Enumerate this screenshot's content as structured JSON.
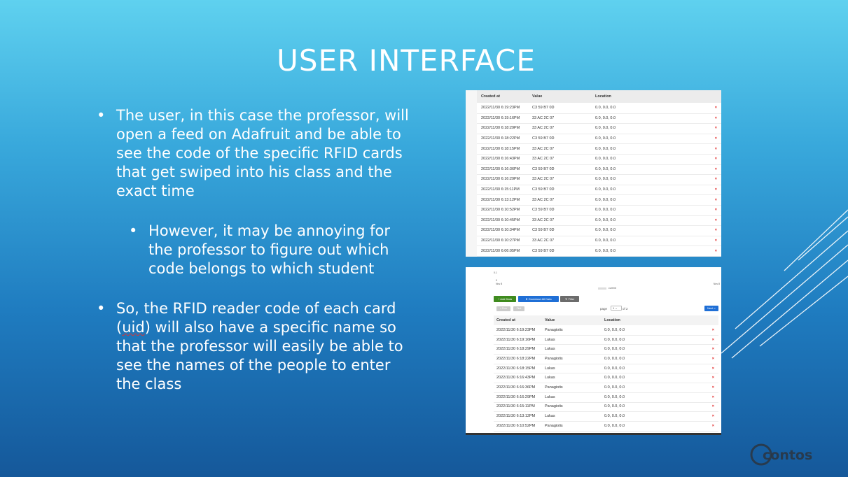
{
  "title": "USER INTERFACE",
  "bullets": {
    "b1": "The user, in this case the professor, will open a feed on Adafruit and be able to see the code of the specific RFID cards that get swiped into his class and the exact time",
    "b2": "However, it may be annoying for the professor to figure out which code belongs to which student",
    "b3_pre": "So, the RFID reader code of each card (",
    "b3_uid": "uid",
    "b3_post": ") will also have a specific name so that the professor will easily be able to see the names of the people to enter the class"
  },
  "panel1": {
    "headers": [
      "Created at",
      "Value",
      "Location"
    ],
    "rows": [
      [
        "2022/11/30 6:19:23PM",
        "C3 59 B7 0D",
        "0.0, 0.0, 0.0"
      ],
      [
        "2022/11/30 6:19:16PM",
        "33 AC 2C 07",
        "0.0, 0.0, 0.0"
      ],
      [
        "2022/11/30 6:18:29PM",
        "33 AC 2C 07",
        "0.0, 0.0, 0.0"
      ],
      [
        "2022/11/30 6:18:22PM",
        "C3 59 B7 0D",
        "0.0, 0.0, 0.0"
      ],
      [
        "2022/11/30 6:18:15PM",
        "33 AC 2C 07",
        "0.0, 0.0, 0.0"
      ],
      [
        "2022/11/30 6:16:43PM",
        "33 AC 2C 07",
        "0.0, 0.0, 0.0"
      ],
      [
        "2022/11/30 6:16:36PM",
        "C3 59 B7 0D",
        "0.0, 0.0, 0.0"
      ],
      [
        "2022/11/30 6:16:29PM",
        "33 AC 2C 07",
        "0.0, 0.0, 0.0"
      ],
      [
        "2022/11/30 6:15:11PM",
        "C3 59 B7 0D",
        "0.0, 0.0, 0.0"
      ],
      [
        "2022/11/30 6:13:12PM",
        "33 AC 2C 07",
        "0.0, 0.0, 0.0"
      ],
      [
        "2022/11/30 6:10:52PM",
        "C3 59 B7 0D",
        "0.0, 0.0, 0.0"
      ],
      [
        "2022/11/30 6:10:45PM",
        "33 AC 2C 07",
        "0.0, 0.0, 0.0"
      ],
      [
        "2022/11/30 6:10:34PM",
        "C3 59 B7 0D",
        "0.0, 0.0, 0.0"
      ],
      [
        "2022/11/30 6:10:27PM",
        "33 AC 2C 07",
        "0.0, 0.0, 0.0"
      ],
      [
        "2022/11/30 6:06:05PM",
        "C3 59 B7 0D",
        "0.0, 0.0, 0.0"
      ]
    ],
    "delete_glyph": "×"
  },
  "panel2": {
    "chart_top_label": "0.1",
    "chart_zero": "0",
    "date_left": "Nov 8",
    "date_right": "Nov 8",
    "legend": "current",
    "add_data": "+ Add Data",
    "download": "Download All Data",
    "filter": "Filter",
    "prev": "< Prev",
    "first": "First",
    "page_label": "page",
    "page_value": "1",
    "page_of": "of 2",
    "next": "Next >",
    "headers": [
      "Created at",
      "Value",
      "Location"
    ],
    "rows": [
      [
        "2022/11/30 6:19:23PM",
        "Panagiotis",
        "0.0, 0.0, 0.0"
      ],
      [
        "2022/11/30 6:19:16PM",
        "Lukas",
        "0.0, 0.0, 0.0"
      ],
      [
        "2022/11/30 6:18:29PM",
        "Lukas",
        "0.0, 0.0, 0.0"
      ],
      [
        "2022/11/30 6:18:22PM",
        "Panagiotis",
        "0.0, 0.0, 0.0"
      ],
      [
        "2022/11/30 6:18:15PM",
        "Lukas",
        "0.0, 0.0, 0.0"
      ],
      [
        "2022/11/30 6:16:43PM",
        "Lukas",
        "0.0, 0.0, 0.0"
      ],
      [
        "2022/11/30 6:16:36PM",
        "Panagiotis",
        "0.0, 0.0, 0.0"
      ],
      [
        "2022/11/30 6:16:29PM",
        "Lukas",
        "0.0, 0.0, 0.0"
      ],
      [
        "2022/11/30 6:15:11PM",
        "Panagiotis",
        "0.0, 0.0, 0.0"
      ],
      [
        "2022/11/30 6:13:12PM",
        "Lukas",
        "0.0, 0.0, 0.0"
      ],
      [
        "2022/11/30 6:10:52PM",
        "Panagiotis",
        "0.0, 0.0, 0.0"
      ]
    ]
  },
  "logo_text": "contoso",
  "colors": {
    "accent_green": "#3f8b1f",
    "accent_blue": "#1f6fd6",
    "delete_red": "#e02020"
  }
}
